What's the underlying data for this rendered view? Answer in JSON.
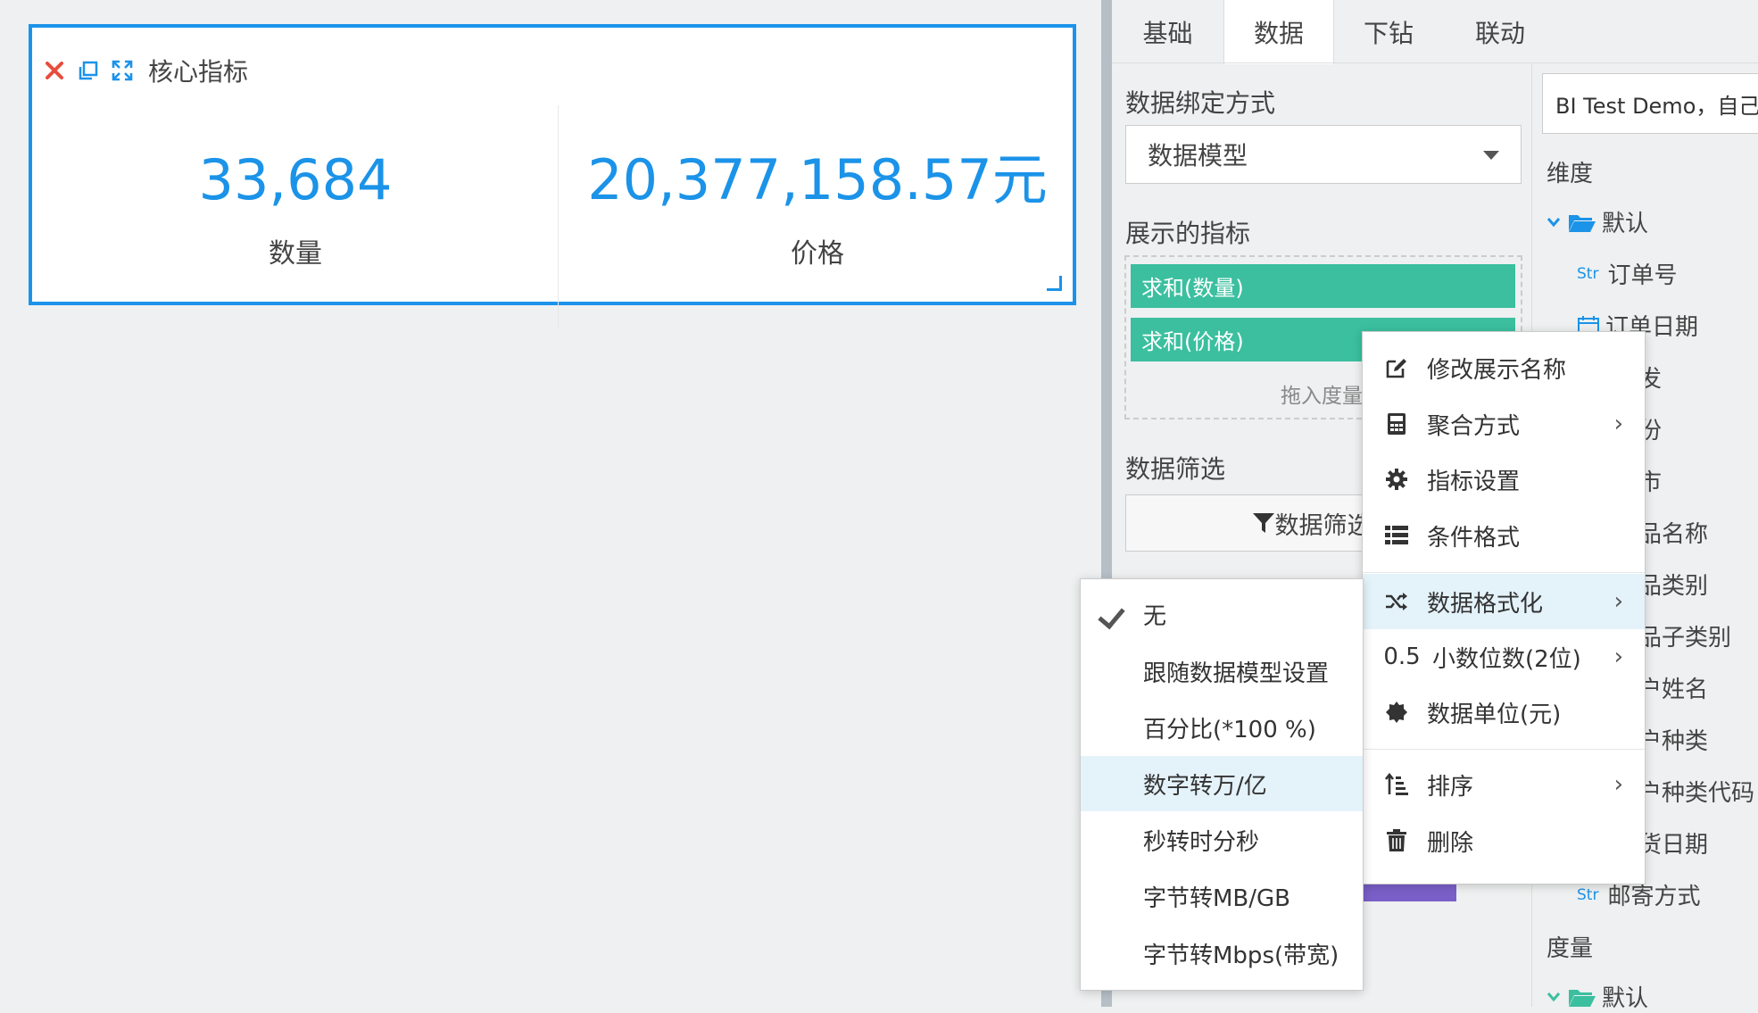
{
  "widget": {
    "title": "核心指标",
    "kpis": [
      {
        "value": "33,684",
        "label": "数量"
      },
      {
        "value": "20,377,158.57元",
        "label": "价格"
      }
    ]
  },
  "tabs": [
    "基础",
    "数据",
    "下钻",
    "联动"
  ],
  "active_tab": "数据",
  "data_binding": {
    "title": "数据绑定方式",
    "selected": "数据模型"
  },
  "indicators": {
    "title": "展示的指标",
    "chips": [
      "求和(数量)",
      "求和(价格)"
    ],
    "drop_hint": "拖入度量"
  },
  "filter": {
    "title": "数据筛选",
    "button": "数据筛选器"
  },
  "model": {
    "name": "BI Test Demo，自己创建"
  },
  "tree": {
    "dimension_title": "维度",
    "default_folder": "默认",
    "str_tag": "Str",
    "items": [
      "订单号",
      "订单日期",
      "发",
      "份",
      "市",
      "品名称",
      "品类别",
      "品子类别",
      "户姓名",
      "户种类",
      "户种类代码",
      "货日期",
      "邮寄方式"
    ],
    "measure_title": "度量",
    "measure_folder": "默认"
  },
  "context_menu": {
    "items": [
      {
        "label": "修改展示名称",
        "icon": "edit-icon"
      },
      {
        "label": "聚合方式",
        "icon": "calculator-icon"
      },
      {
        "label": "指标设置",
        "icon": "gear-icon"
      },
      {
        "label": "条件格式",
        "icon": "list-icon"
      },
      {
        "label": "数据格式化",
        "icon": "shuffle-icon"
      },
      {
        "label": "小数位数(2位)",
        "icon": "decimal-icon",
        "icon_text": "0.5"
      },
      {
        "label": "数据单位(元)",
        "icon": "badge-icon"
      },
      {
        "label": "排序",
        "icon": "sort-icon"
      },
      {
        "label": "删除",
        "icon": "trash-icon"
      }
    ]
  },
  "format_submenu": {
    "selected": "无",
    "items": [
      "无",
      "跟随数据模型设置",
      "百分比(*100 %)",
      "数字转万/亿",
      "秒转时分秒",
      "字节转MB/GB",
      "字节转Mbps(带宽)"
    ]
  },
  "colors": {
    "accent": "#1b93e8",
    "chip": "#3bbf9f",
    "close": "#e74c3c"
  }
}
